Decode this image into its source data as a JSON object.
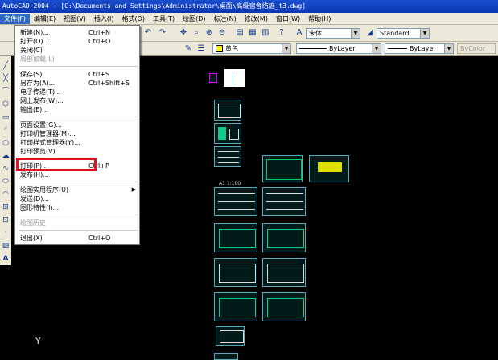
{
  "window": {
    "title": "AutoCAD 2004 - [C:\\Documents and Settings\\Administrator\\桌面\\高级宿舍结施_t3.dwg]"
  },
  "menubar": [
    {
      "label": "文件(F)",
      "active": true
    },
    {
      "label": "编辑(E)"
    },
    {
      "label": "视图(V)"
    },
    {
      "label": "插入(I)"
    },
    {
      "label": "格式(O)"
    },
    {
      "label": "工具(T)"
    },
    {
      "label": "绘图(D)"
    },
    {
      "label": "标注(N)"
    },
    {
      "label": "修改(M)"
    },
    {
      "label": "窗口(W)"
    },
    {
      "label": "帮助(H)"
    }
  ],
  "toolbar": {
    "text_style": "宋体",
    "dim_style": "Standard",
    "color": "黄色",
    "linetype": "ByLayer",
    "lineweight": "ByLayer",
    "plotstyle": "ByColor"
  },
  "file_menu": {
    "items": [
      {
        "label": "新建(N)...",
        "shortcut": "Ctrl+N"
      },
      {
        "label": "打开(O)...",
        "shortcut": "Ctrl+O"
      },
      {
        "label": "关闭(C)",
        "shortcut": ""
      },
      {
        "label": "局部加载(L)",
        "shortcut": "",
        "disabled": true
      },
      {
        "label": "保存(S)",
        "shortcut": "Ctrl+S"
      },
      {
        "label": "另存为(A)...",
        "shortcut": "Ctrl+Shift+S"
      },
      {
        "label": "电子传递(T)...",
        "shortcut": ""
      },
      {
        "label": "网上发布(W)...",
        "shortcut": ""
      },
      {
        "label": "输出(E)...",
        "shortcut": ""
      },
      {
        "label": "页面设置(G)...",
        "shortcut": ""
      },
      {
        "label": "打印机管理器(M)...",
        "shortcut": ""
      },
      {
        "label": "打印样式管理器(Y)...",
        "shortcut": ""
      },
      {
        "label": "打印预览(V)",
        "shortcut": ""
      },
      {
        "label": "打印(P)...",
        "shortcut": "Ctrl+P"
      },
      {
        "label": "发布(H)...",
        "shortcut": ""
      },
      {
        "label": "绘图实用程序(U)",
        "shortcut": "",
        "submenu": true
      },
      {
        "label": "发送(D)...",
        "shortcut": ""
      },
      {
        "label": "图形特性(I)...",
        "shortcut": ""
      },
      {
        "label": "绘图历史",
        "shortcut": "",
        "disabled": true
      },
      {
        "label": "退出(X)",
        "shortcut": "Ctrl+Q"
      }
    ]
  },
  "drawing": {
    "scale_label": "A1 1:100",
    "axis_label": "Y"
  },
  "colors": {
    "highlight": "#e0141e",
    "thumb_border": "#55aabb",
    "title_bar": "#1b4fcf"
  }
}
